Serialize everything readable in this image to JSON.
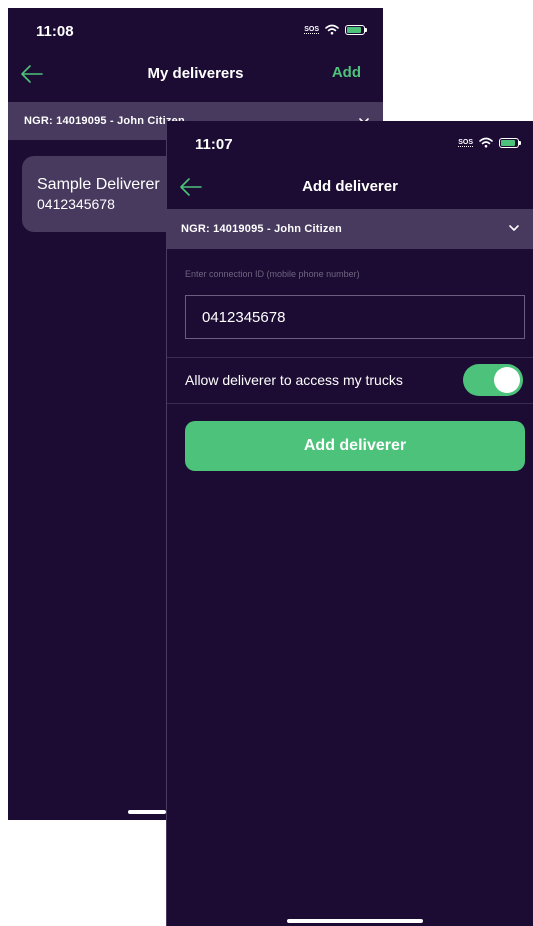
{
  "screens": {
    "deliverers": {
      "status": {
        "time": "11:08",
        "sos": "SOS"
      },
      "nav": {
        "title": "My deliverers",
        "action": "Add"
      },
      "account": {
        "label": "NGR: 14019095 - John Citizen"
      },
      "deliverers": [
        {
          "name": "Sample Deliverer",
          "phone": "0412345678"
        }
      ]
    },
    "add_deliverer": {
      "status": {
        "time": "11:07",
        "sos": "SOS"
      },
      "nav": {
        "title": "Add deliverer"
      },
      "account": {
        "label": "NGR: 14019095 - John Citizen"
      },
      "form": {
        "connection_id_hint": "Enter connection ID (mobile phone number)",
        "connection_id_value": "0412345678",
        "allow_access_label": "Allow deliverer to access my trucks",
        "allow_access_enabled": true,
        "submit_label": "Add deliverer"
      }
    }
  },
  "icons": {
    "back": "arrow-left-icon",
    "account_dropdown": "chevron-down-icon",
    "signal": "wifi-icon",
    "battery": "battery-charging-icon"
  },
  "colors": {
    "background": "#1c0c33",
    "panel": "#473a5e",
    "accent": "#4cc27a",
    "text": "#ffffff"
  }
}
